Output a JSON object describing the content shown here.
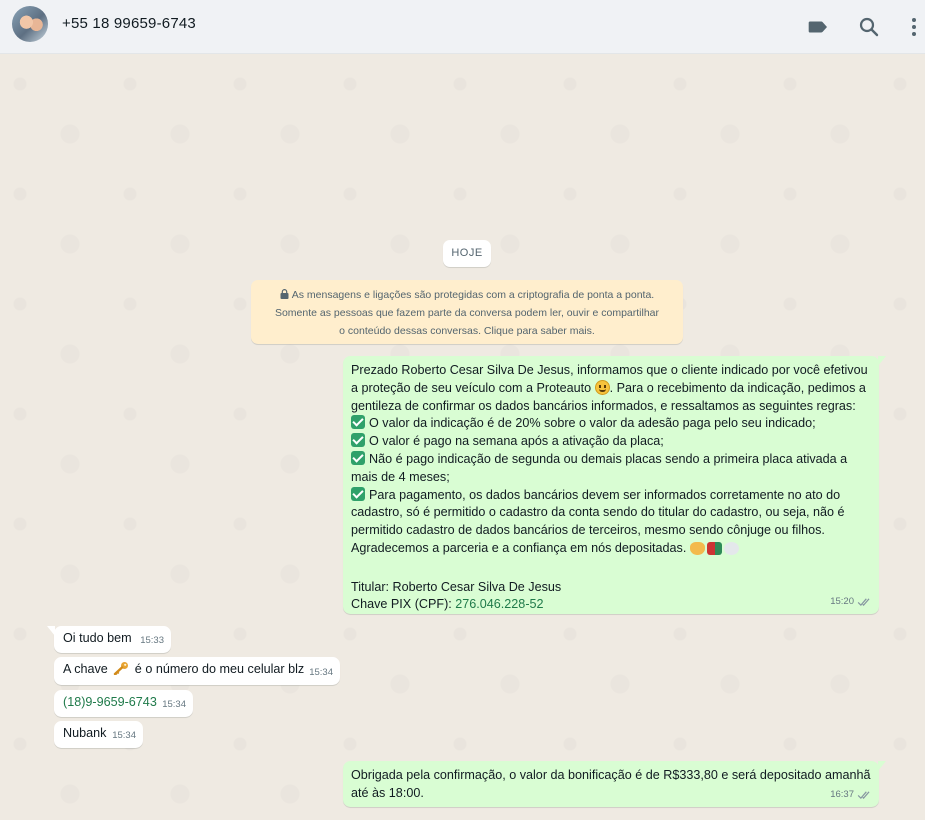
{
  "header": {
    "contact_name": "+55 18 99659-6743",
    "icons": [
      "label-icon",
      "search-icon",
      "menu-dots-icon"
    ]
  },
  "date_chip": "HOJE",
  "encryption_notice": {
    "line1": "As mensagens e ligações são protegidas com a criptografia de ponta a ponta.",
    "line2": "Somente as pessoas que fazem parte da conversa podem ler, ouvir e compartilhar",
    "line3": "o conteúdo dessas conversas. Clique para saber mais."
  },
  "messages": [
    {
      "direction": "out",
      "time": "15:20",
      "lines": {
        "l1": "Prezado Roberto Cesar Silva De Jesus, informamos que o cliente indicado por você efetivou",
        "l2a": "a proteção de seu veículo com a Proteauto ",
        "l2b": ". Para o recebimento da indicação, pedimos a",
        "l3": "gentileza de confirmar os dados bancários informados, e  ressaltamos as seguintes regras:",
        "l4": "O valor da indicação é de 20% sobre o valor da adesão paga pelo seu indicado;",
        "l5": "O valor é pago na semana após a ativação da placa;",
        "l6": "Não é pago indicação de segunda ou demais placas sendo a primeira placa ativada a",
        "l7": "mais de 4 meses;",
        "l8": "Para pagamento, os dados bancários devem ser informados corretamente no ato do",
        "l9": "cadastro, só é permitido o cadastro da conta sendo do titular do cadastro, ou seja, não é",
        "l10": "permitido cadastro de dados bancários de terceiros, mesmo sendo cônjuge ou filhos.",
        "l11": "Agradecemos a parceria e a confiança em nós depositadas. ",
        "l12": "Titular: Roberto Cesar Silva De Jesus",
        "l13a": "Chave PIX (CPF): ",
        "l13b": "276.046.228-52"
      }
    },
    {
      "direction": "in",
      "time": "15:33",
      "text": "Oi tudo bem"
    },
    {
      "direction": "in",
      "time": "15:34",
      "text_a": "A chave ",
      "text_b": " é o número do meu celular blz"
    },
    {
      "direction": "in",
      "time": "15:34",
      "text": "(18)9-9659-6743"
    },
    {
      "direction": "in",
      "time": "15:34",
      "text": "Nubank"
    },
    {
      "direction": "out",
      "time": "16:37",
      "l1": "Obrigada pela confirmação, o valor da bonificação é de R$333,80 e será depositado amanhã",
      "l2": "até às 18:00."
    }
  ]
}
